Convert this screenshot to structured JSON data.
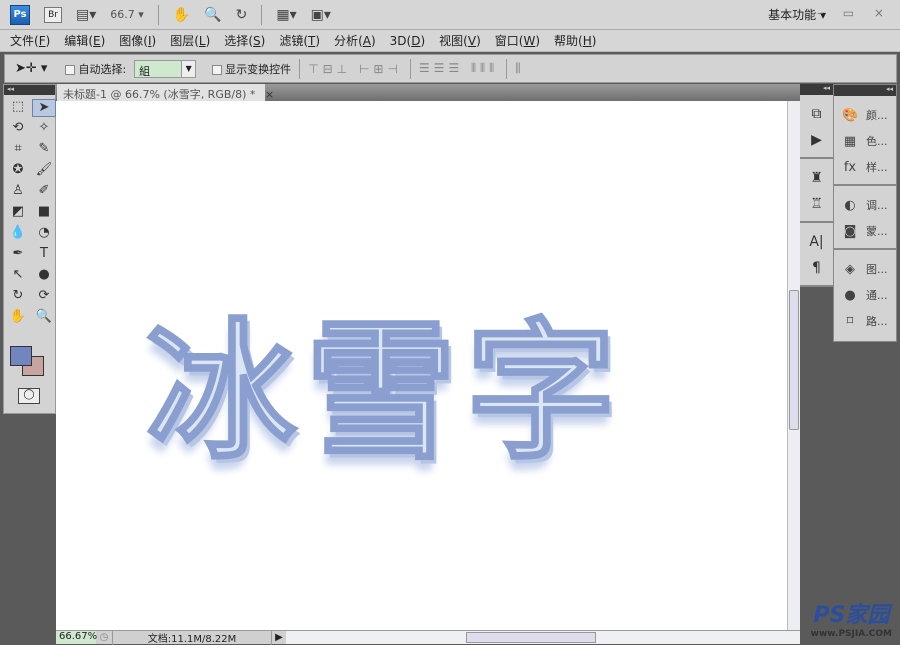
{
  "titlebar": {
    "ps_logo": "Ps",
    "bridge": "Br",
    "zoom": "66.7",
    "workspace": "基本功能",
    "window_controls": "– ▭ ×"
  },
  "menu": [
    {
      "label": "文件",
      "key": "F"
    },
    {
      "label": "编辑",
      "key": "E"
    },
    {
      "label": "图像",
      "key": "I"
    },
    {
      "label": "图层",
      "key": "L"
    },
    {
      "label": "选择",
      "key": "S"
    },
    {
      "label": "滤镜",
      "key": "T"
    },
    {
      "label": "分析",
      "key": "A"
    },
    {
      "label": "3D",
      "key": "D"
    },
    {
      "label": "视图",
      "key": "V"
    },
    {
      "label": "窗口",
      "key": "W"
    },
    {
      "label": "帮助",
      "key": "H"
    }
  ],
  "options": {
    "auto_select_label": "自动选择:",
    "auto_select_value": "組",
    "show_transform_label": "显示变换控件"
  },
  "document": {
    "tab_title": "未标题-1 @ 66.7% (冰雪字, RGB/8) *",
    "close": "×",
    "artwork_text": "冰雪字"
  },
  "colors": {
    "foreground": "#7186c0",
    "background": "#c7a59e"
  },
  "status": {
    "zoom": "66.67%",
    "doc_info": "文档:11.1M/8.22M"
  },
  "panels": [
    {
      "icon": "color-icon",
      "label": "颜..."
    },
    {
      "icon": "swatches-icon",
      "label": "色..."
    },
    {
      "icon": "styles-icon",
      "label": "样..."
    },
    {
      "icon": "adjustments-icon",
      "label": "调..."
    },
    {
      "icon": "masks-icon",
      "label": "蒙..."
    },
    {
      "icon": "layers-icon",
      "label": "图..."
    },
    {
      "icon": "channels-icon",
      "label": "通..."
    },
    {
      "icon": "paths-icon",
      "label": "路..."
    }
  ],
  "watermark": {
    "brand": "PS家园",
    "url": "www.PSJIA.COM"
  }
}
